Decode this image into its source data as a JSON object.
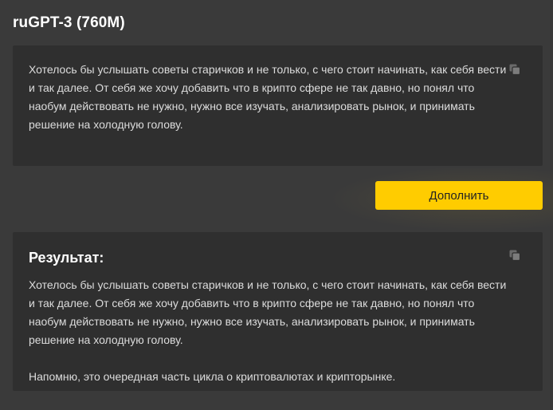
{
  "header": {
    "title": "ruGPT-3 (760M)"
  },
  "input": {
    "text": "Хотелось бы услышать советы старичков и не только, с чего стоит начинать, как себя вести и так далее. От себя же хочу добавить что в крипто сфере не так давно, но понял что наобум действовать не нужно, нужно все изучать, анализировать рынок, и принимать решение на холодную голову.",
    "copy_icon": "copy-icon"
  },
  "action": {
    "label": "Дополнить"
  },
  "result": {
    "title": "Результат:",
    "paragraph1": "Хотелось бы услышать советы старичков и не только, с чего стоит начинать, как себя вести и так далее. От себя же хочу добавить что в крипто сфере не так давно, но понял что наобум действовать не нужно, нужно все изучать, анализировать рынок, и принимать решение на холодную голову.",
    "paragraph2": "Напомню, это очередная часть цикла о криптовалютах и крипторынке.",
    "copy_icon": "copy-icon"
  },
  "colors": {
    "background": "#3a3a3a",
    "panel": "#2f2f2f",
    "accent": "#ffcc00"
  }
}
